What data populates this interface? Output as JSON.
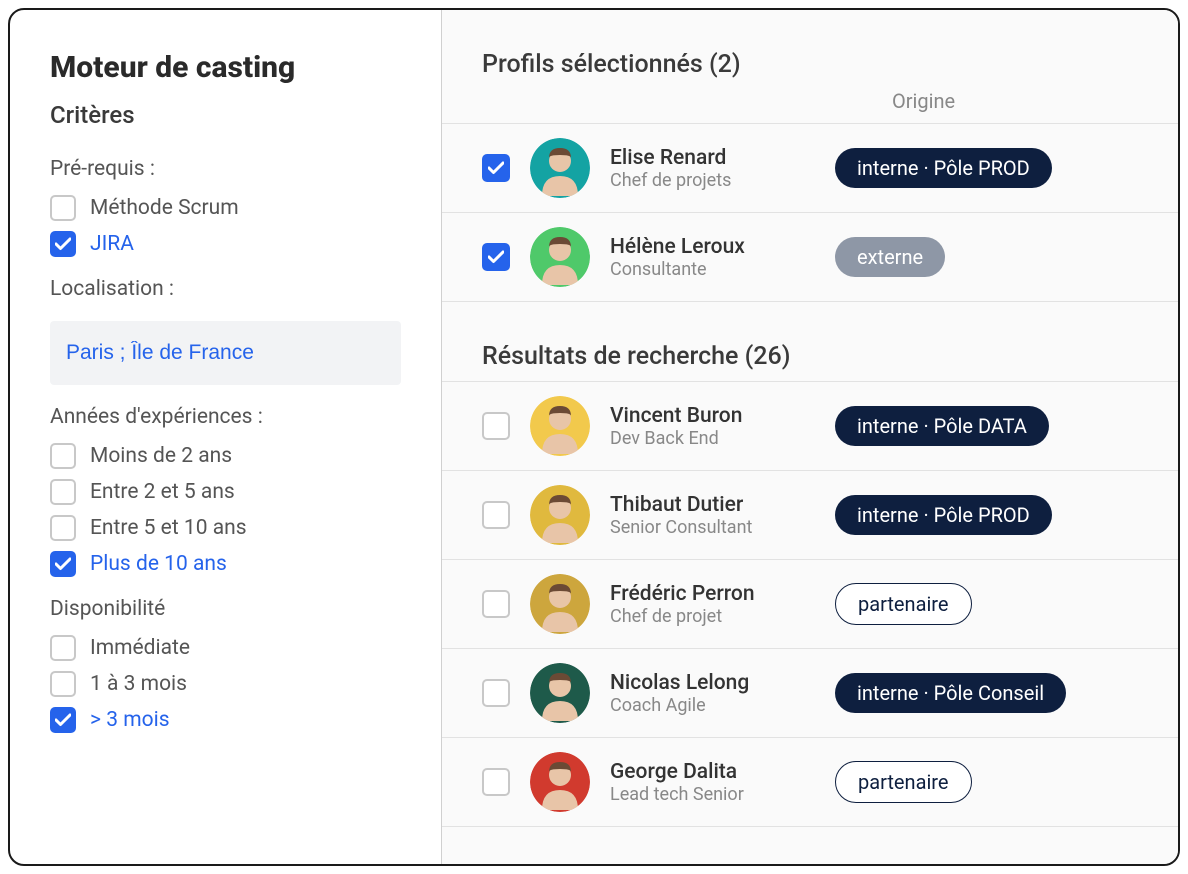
{
  "sidebar": {
    "title": "Moteur de casting",
    "subtitle": "Critères",
    "prereq_label": "Pré-requis :",
    "prereq_items": [
      {
        "label": "Méthode Scrum",
        "checked": false
      },
      {
        "label": "JIRA",
        "checked": true
      }
    ],
    "location_label": "Localisation :",
    "location_value": "Paris ; Île de France",
    "experience_label": "Années d'expériences :",
    "experience_items": [
      {
        "label": "Moins de 2 ans",
        "checked": false
      },
      {
        "label": "Entre 2 et 5 ans",
        "checked": false
      },
      {
        "label": "Entre 5 et 10 ans",
        "checked": false
      },
      {
        "label": "Plus de 10 ans",
        "checked": true
      }
    ],
    "availability_label": "Disponibilité",
    "availability_items": [
      {
        "label": "Immédiate",
        "checked": false
      },
      {
        "label": "1 à 3 mois",
        "checked": false
      },
      {
        "label": "> 3 mois",
        "checked": true
      }
    ]
  },
  "main": {
    "selected_title": "Profils sélectionnés (2)",
    "origin_header": "Origine",
    "results_title": "Résultats de recherche (26)",
    "selected": [
      {
        "name": "Elise Renard",
        "role": "Chef de projets",
        "badge": "interne · Pôle PROD",
        "badge_type": "dark",
        "checked": true,
        "avatar_bg": "#14a3a3"
      },
      {
        "name": "Hélène Leroux",
        "role": "Consultante",
        "badge": "externe",
        "badge_type": "gray",
        "checked": true,
        "avatar_bg": "#4fc96a"
      }
    ],
    "results": [
      {
        "name": "Vincent Buron",
        "role": "Dev Back End",
        "badge": "interne · Pôle DATA",
        "badge_type": "dark",
        "checked": false,
        "avatar_bg": "#f2c94c"
      },
      {
        "name": "Thibaut Dutier",
        "role": "Senior Consultant",
        "badge": "interne · Pôle PROD",
        "badge_type": "dark",
        "checked": false,
        "avatar_bg": "#e0b93e"
      },
      {
        "name": "Frédéric Perron",
        "role": "Chef de projet",
        "badge": "partenaire",
        "badge_type": "outline",
        "checked": false,
        "avatar_bg": "#cda63d"
      },
      {
        "name": "Nicolas Lelong",
        "role": "Coach Agile",
        "badge": "interne · Pôle Conseil",
        "badge_type": "dark",
        "checked": false,
        "avatar_bg": "#1e5a4a"
      },
      {
        "name": "George Dalita",
        "role": "Lead tech Senior",
        "badge": "partenaire",
        "badge_type": "outline",
        "checked": false,
        "avatar_bg": "#d13a2e"
      }
    ]
  }
}
